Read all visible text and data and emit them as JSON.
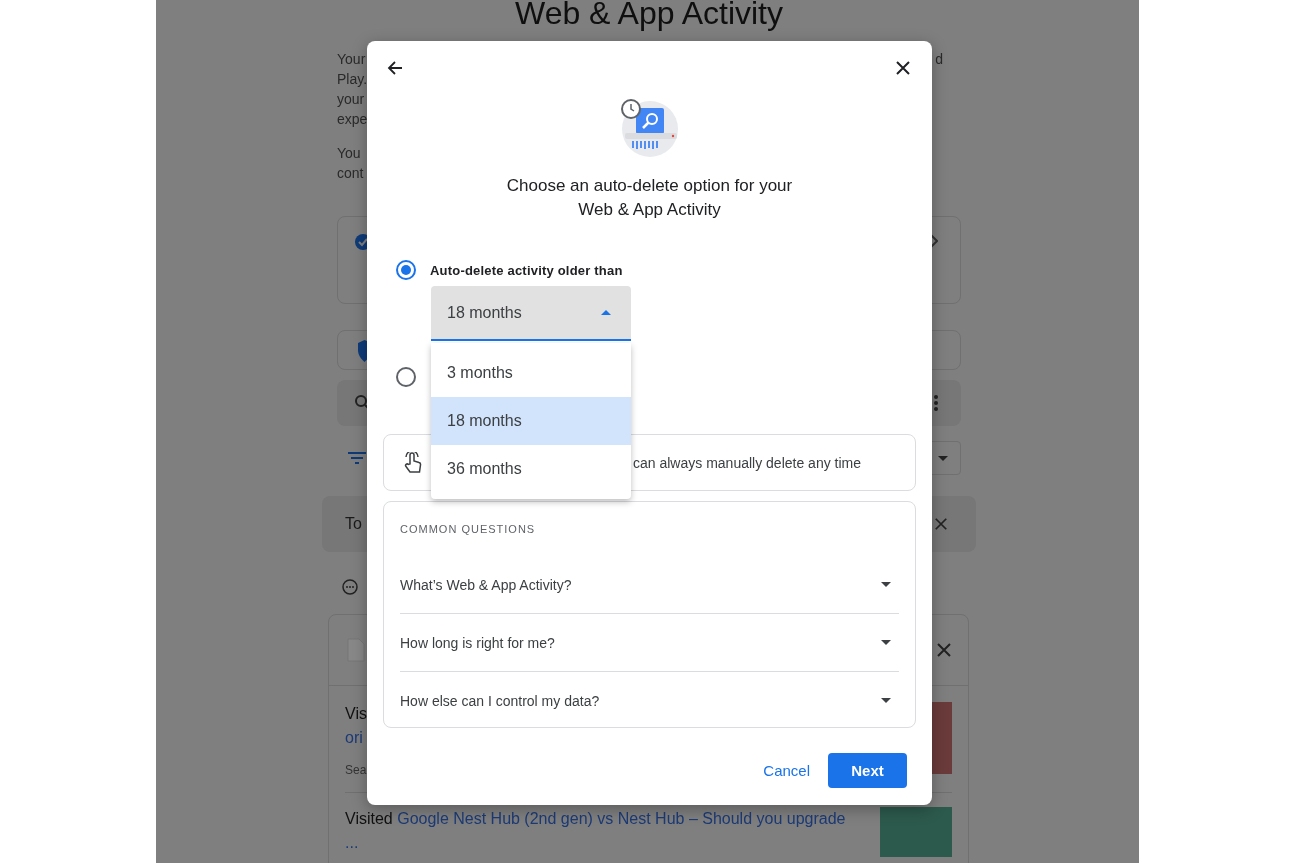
{
  "page": {
    "title": "Web & App Activity",
    "intro_lines": [
      "Your",
      "Play.",
      "your",
      "expe"
    ],
    "intro_right": "d",
    "note_lines": [
      "You",
      "cont"
    ],
    "banner": {
      "text": "To"
    },
    "item1": {
      "title": "Vis",
      "link": "ori",
      "meta": "Sea"
    },
    "item2": {
      "prefix": "Visited",
      "link": "Google Nest Hub (2nd gen) vs Nest Hub – Should you upgrade",
      "more": "..."
    }
  },
  "dialog": {
    "title": "Choose an auto-delete option for your Web & App Activity",
    "options": [
      {
        "label": "Auto-delete activity older than",
        "selected": true
      },
      {
        "selected": false
      }
    ],
    "select": {
      "value": "18 months",
      "expanded": true,
      "options": [
        {
          "label": "3 months",
          "selected": false
        },
        {
          "label": "18 months",
          "selected": true
        },
        {
          "label": "36 months",
          "selected": false
        }
      ]
    },
    "info": "can always manually delete any time",
    "questions": {
      "heading": "COMMON QUESTIONS",
      "items": [
        {
          "text": "What’s Web & App Activity?",
          "expanded": false
        },
        {
          "text": "How long is right for me?",
          "expanded": false
        },
        {
          "text": "How else can I control my data?",
          "expanded": false
        }
      ]
    },
    "buttons": [
      {
        "label": "Cancel",
        "kind": "text"
      },
      {
        "label": "Next",
        "kind": "primary"
      }
    ]
  }
}
